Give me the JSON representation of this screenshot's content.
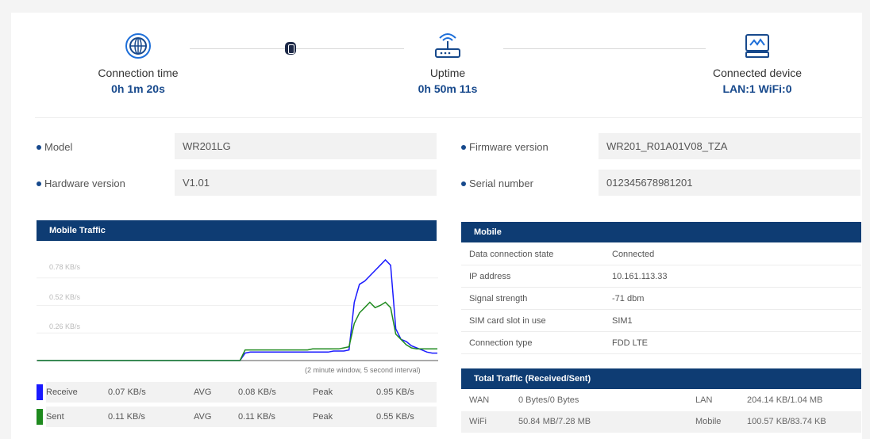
{
  "status": {
    "connection_time": {
      "label": "Connection time",
      "value": "0h 1m 20s",
      "icon": "globe-icon"
    },
    "uptime": {
      "label": "Uptime",
      "value": "0h 50m 11s",
      "icon": "router-icon"
    },
    "connected_device": {
      "label": "Connected device",
      "value": "LAN:1 WiFi:0",
      "icon": "monitor-icon"
    }
  },
  "info": {
    "model": {
      "label": "Model",
      "value": "WR201LG"
    },
    "hardware": {
      "label": "Hardware version",
      "value": "V1.01"
    },
    "firmware": {
      "label": "Firmware version",
      "value": "WR201_R01A01V08_TZA"
    },
    "serial": {
      "label": "Serial number",
      "value": "012345678981201"
    }
  },
  "mobile_traffic": {
    "title": "Mobile Traffic",
    "note": "(2 minute window, 5 second interval)",
    "y_ticks": [
      "0.78 KB/s",
      "0.52 KB/s",
      "0.26 KB/s"
    ],
    "rows": [
      {
        "label": "Receive",
        "value": "0.07 KB/s",
        "avg_label": "AVG",
        "avg": "0.08 KB/s",
        "peak_label": "Peak",
        "peak": "0.95 KB/s",
        "color": "#1a1aff"
      },
      {
        "label": "Sent",
        "value": "0.11 KB/s",
        "avg_label": "AVG",
        "avg": "0.11 KB/s",
        "peak_label": "Peak",
        "peak": "0.55 KB/s",
        "color": "#1f8a1f"
      }
    ]
  },
  "chart_data": {
    "type": "line",
    "ylim": [
      0,
      1.04
    ],
    "y_ticks": [
      0.26,
      0.52,
      0.78
    ],
    "series": [
      {
        "name": "Receive",
        "color": "#1a1aff",
        "values": [
          0,
          0,
          0,
          0,
          0,
          0,
          0,
          0,
          0,
          0,
          0,
          0,
          0,
          0,
          0,
          0,
          0,
          0,
          0,
          0,
          0,
          0,
          0,
          0,
          0,
          0,
          0,
          0,
          0,
          0,
          0,
          0,
          0,
          0,
          0,
          0,
          0,
          0,
          0,
          0,
          0.07,
          0.08,
          0.08,
          0.08,
          0.08,
          0.08,
          0.08,
          0.08,
          0.08,
          0.08,
          0.08,
          0.08,
          0.08,
          0.08,
          0.08,
          0.08,
          0.08,
          0.09,
          0.09,
          0.09,
          0.1,
          0.55,
          0.72,
          0.75,
          0.8,
          0.85,
          0.9,
          0.95,
          0.9,
          0.3,
          0.2,
          0.18,
          0.14,
          0.12,
          0.1,
          0.08,
          0.07,
          0.07
        ]
      },
      {
        "name": "Sent",
        "color": "#1f8a1f",
        "values": [
          0,
          0,
          0,
          0,
          0,
          0,
          0,
          0,
          0,
          0,
          0,
          0,
          0,
          0,
          0,
          0,
          0,
          0,
          0,
          0,
          0,
          0,
          0,
          0,
          0,
          0,
          0,
          0,
          0,
          0,
          0,
          0,
          0,
          0,
          0,
          0,
          0,
          0,
          0,
          0,
          0.1,
          0.1,
          0.1,
          0.1,
          0.1,
          0.1,
          0.1,
          0.1,
          0.1,
          0.1,
          0.1,
          0.1,
          0.1,
          0.11,
          0.11,
          0.11,
          0.11,
          0.11,
          0.11,
          0.12,
          0.13,
          0.35,
          0.45,
          0.5,
          0.55,
          0.5,
          0.52,
          0.55,
          0.5,
          0.25,
          0.2,
          0.15,
          0.12,
          0.11,
          0.11,
          0.11,
          0.11,
          0.11
        ]
      }
    ]
  },
  "mobile": {
    "title": "Mobile",
    "rows": [
      {
        "key": "Data connection state",
        "value": "Connected"
      },
      {
        "key": "IP address",
        "value": "10.161.113.33"
      },
      {
        "key": "Signal strength",
        "value": "-71 dbm"
      },
      {
        "key": "SIM card slot in use",
        "value": "SIM1"
      },
      {
        "key": "Connection type",
        "value": "FDD LTE"
      }
    ]
  },
  "total_traffic": {
    "title": "Total Traffic (Received/Sent)",
    "rows": [
      {
        "k1": "WAN",
        "v1": "0 Bytes/0 Bytes",
        "k2": "LAN",
        "v2": "204.14 KB/1.04 MB"
      },
      {
        "k1": "WiFi",
        "v1": "50.84 MB/7.28 MB",
        "k2": "Mobile",
        "v2": "100.57 KB/83.74 KB"
      }
    ]
  }
}
